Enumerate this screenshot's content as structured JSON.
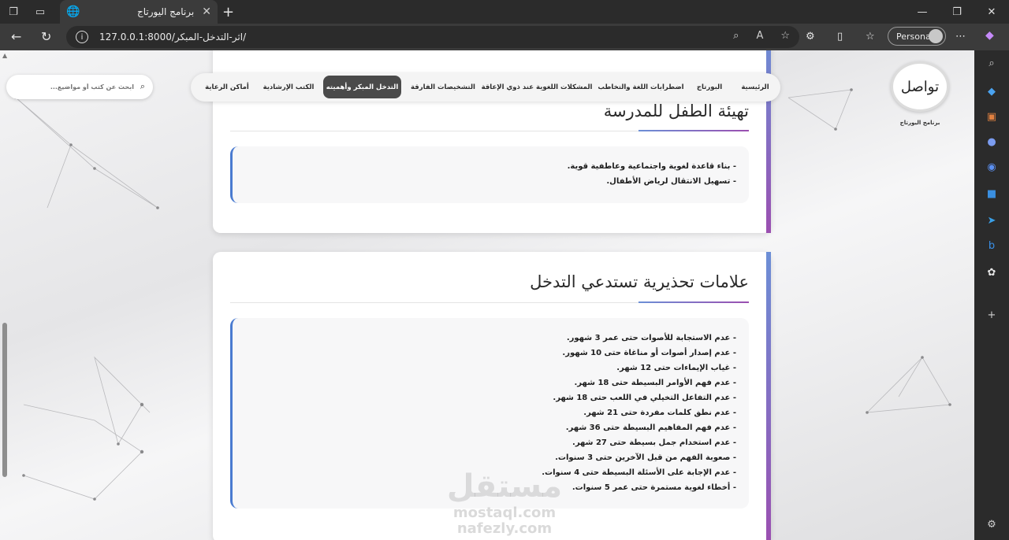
{
  "browser": {
    "tab_title": "برنامج اليورتاج",
    "url": "127.0.0.1:8000/اثر-التدخل-المبكر/",
    "profile_label": "Personal"
  },
  "site": {
    "logo_text": "تواصل",
    "logo_subtitle": "برنامج اليورتاج",
    "search_placeholder": "ابحث عن كتب أو مواضيع...",
    "nav": [
      {
        "label": "الرئيسية",
        "active": false
      },
      {
        "label": "البورتاج",
        "active": false
      },
      {
        "label": "اضطرابات اللغة والتخاطب",
        "active": false
      },
      {
        "label": "المشكلات اللغوية عند ذوي الإعاقة",
        "active": false
      },
      {
        "label": "التشخيصات الفارقة",
        "active": false
      },
      {
        "label": "التدخل المبكر وأهميته",
        "active": true
      },
      {
        "label": "الكتب الإرشادية",
        "active": false
      },
      {
        "label": "أماكن الرعاية",
        "active": false
      }
    ]
  },
  "sections": [
    {
      "heading": "تهيئة الطفل للمدرسة",
      "items": [
        "- بناء قاعدة لغوية واجتماعية وعاطفية قوية.",
        "- تسهيل الانتقال لرياض الأطفال."
      ]
    },
    {
      "heading": "علامات تحذيرية تستدعي التدخل",
      "items": [
        "- عدم الاستجابة للأصوات حتى عمر 3 شهور.",
        "- عدم إصدار أصوات أو مناغاة حتى 10 شهور.",
        "- غياب الإيماءات حتى 12 شهر.",
        "- عدم فهم الأوامر البسيطة حتى 18 شهر.",
        "- عدم التفاعل التخيلي في اللعب حتى 18 شهر.",
        "- عدم نطق كلمات مفردة حتى 21 شهر.",
        "- عدم فهم المفاهيم البسيطة حتى 36 شهر.",
        "- عدم استخدام جمل بسيطة حتى 27 شهر.",
        "- صعوبة الفهم من قبل الآخرين حتى 3 سنوات.",
        "- عدم الإجابة على الأسئلة البسيطة حتى 4 سنوات.",
        "- أخطاء لغوية مستمرة حتى عمر 5 سنوات."
      ]
    }
  ],
  "watermark": {
    "line1": "مستقل",
    "line2": "mostaql.com",
    "line3": "nafezly.com"
  },
  "colors": {
    "accent_blue": "#4a7bd0",
    "accent_purple": "#9b4fb0",
    "nav_active_bg": "#4a4a4a"
  }
}
